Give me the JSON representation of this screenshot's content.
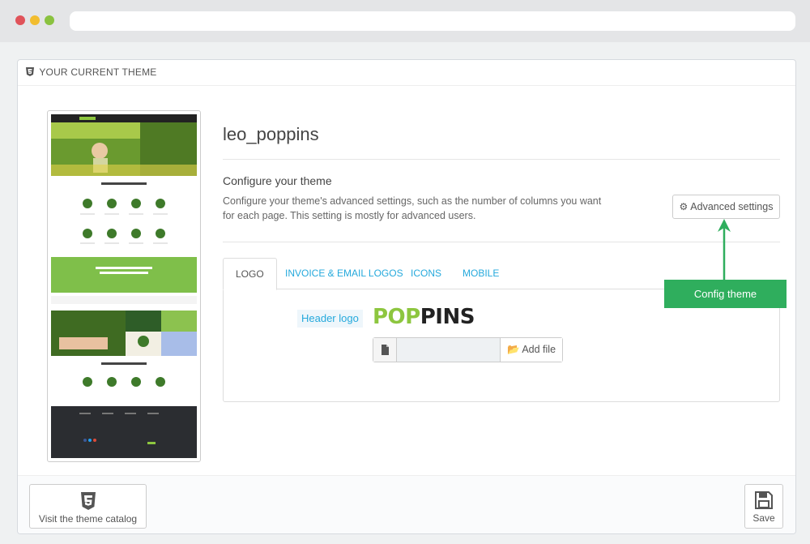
{
  "panel": {
    "title": "YOUR CURRENT THEME"
  },
  "theme": {
    "name": "leo_poppins",
    "configure_title": "Configure your theme",
    "configure_desc": "Configure your theme's advanced settings, such as the number of columns you want for each page. This setting is mostly for advanced users.",
    "advanced_button": "Advanced settings"
  },
  "tabs": [
    {
      "label": "LOGO",
      "active": true
    },
    {
      "label": "INVOICE & EMAIL LOGOS",
      "active": false
    },
    {
      "label": "ICONS",
      "active": false
    },
    {
      "label": "MOBILE",
      "active": false
    }
  ],
  "logo_tab": {
    "header_logo_label": "Header logo",
    "logo_pop": "POP",
    "logo_pins": "PINS",
    "add_file_label": "Add file"
  },
  "callout": {
    "text": "Config theme",
    "color": "#2fae5d"
  },
  "footer": {
    "catalog_label": "Visit the theme catalog",
    "save_label": "Save"
  },
  "colors": {
    "accent": "#25a9dc",
    "callout_green": "#2fae5d",
    "logo_green": "#8dc63f"
  },
  "icons": [
    "html5-icon",
    "gear-icon",
    "file-icon",
    "folder-open-icon",
    "save-icon"
  ]
}
